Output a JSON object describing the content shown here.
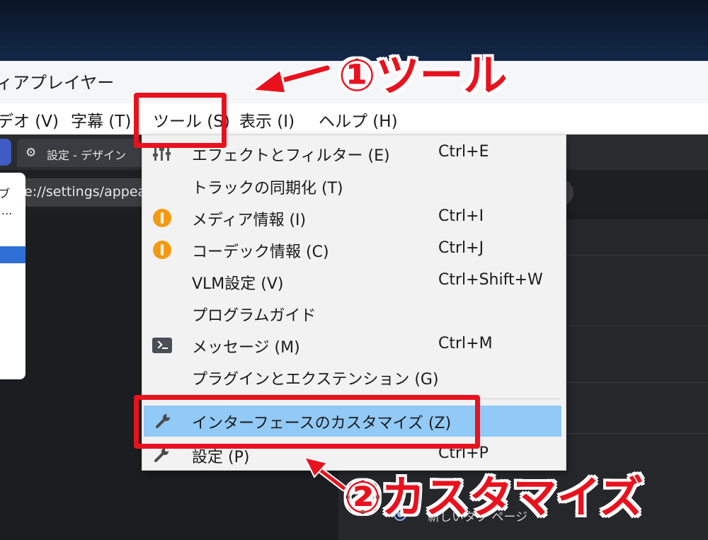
{
  "window": {
    "title": "ィアプレイヤー"
  },
  "menubar": {
    "items": [
      {
        "label": "デオ (V)"
      },
      {
        "label": "字幕 (T)"
      },
      {
        "label": "ツール (S)"
      },
      {
        "label": "表示 (I)"
      },
      {
        "label": "ヘルプ (H)"
      }
    ]
  },
  "browser": {
    "tab_label": "設定 - デザイン",
    "url": "e://settings/appeara",
    "side_popup": {
      "line1": "ブ",
      "line2": "..."
    },
    "radio_label": "新しいタブ ページ"
  },
  "tools_menu": {
    "items": [
      {
        "icon": "equalizer-icon",
        "label": "エフェクトとフィルター (E)",
        "shortcut": "Ctrl+E"
      },
      {
        "icon": "",
        "label": "トラックの同期化 (T)",
        "shortcut": ""
      },
      {
        "icon": "info-icon",
        "label": "メディア情報 (I)",
        "shortcut": "Ctrl+I"
      },
      {
        "icon": "info-icon",
        "label": "コーデック情報 (C)",
        "shortcut": "Ctrl+J"
      },
      {
        "icon": "",
        "label": "VLM設定 (V)",
        "shortcut": "Ctrl+Shift+W"
      },
      {
        "icon": "",
        "label": "プログラムガイド",
        "shortcut": ""
      },
      {
        "icon": "terminal-icon",
        "label": "メッセージ (M)",
        "shortcut": "Ctrl+M"
      },
      {
        "icon": "",
        "label": "プラグインとエクステンション (G)",
        "shortcut": ""
      },
      {
        "icon": "wrench-icon",
        "label": "インターフェースのカスタマイズ (Z)",
        "shortcut": ""
      },
      {
        "icon": "wrench-icon",
        "label": "設定 (P)",
        "shortcut": "Ctrl+P"
      }
    ],
    "highlight_color": "#91c9f7"
  },
  "annotations": {
    "step1": "①ツール",
    "step2": "②カスタマイズ",
    "color": "#e8121e"
  }
}
